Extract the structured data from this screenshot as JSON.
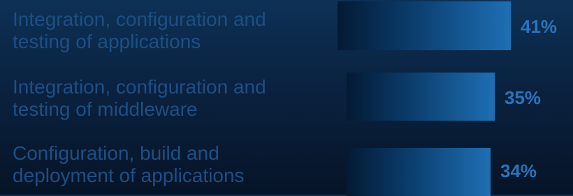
{
  "chart_data": {
    "type": "bar",
    "orientation": "horizontal",
    "categories": [
      "Integration, configuration and\ntesting of applications",
      "Integration, configuration and\ntesting of middleware",
      "Configuration, build and\ndeployment of applications"
    ],
    "values": [
      41,
      35,
      34
    ],
    "value_labels": [
      "41%",
      "35%",
      "34%"
    ],
    "unit": "%",
    "xlim": [
      0,
      41
    ],
    "grid": false,
    "colors": {
      "background": "#0a2240",
      "bar_start": "#041a34",
      "bar_end": "#1e6fb4",
      "label": "#1e4f84",
      "value_label": "#2c73ba"
    }
  }
}
